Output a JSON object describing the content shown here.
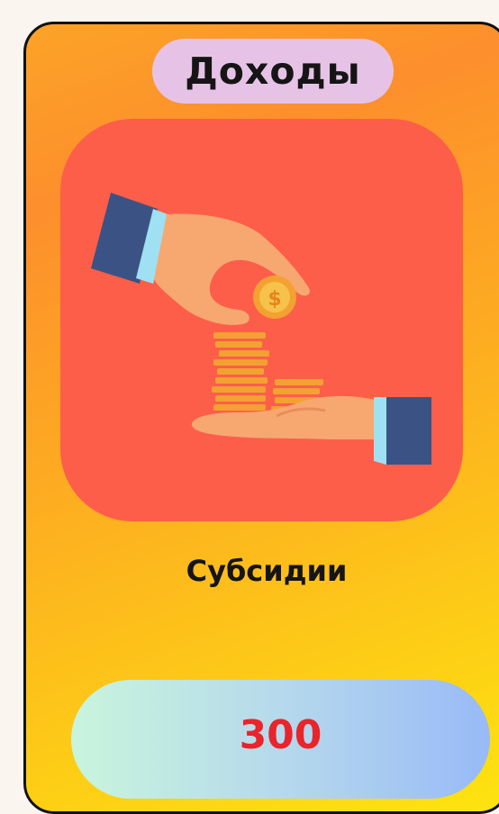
{
  "card": {
    "title": "Доходы",
    "label": "Субсидии",
    "value": "300",
    "illustration": "hands-giving-coins",
    "colors": {
      "card_gradient_top": "#fd8f2c",
      "card_gradient_bottom": "#fde40f",
      "title_pill": "#e6c3e6",
      "image_background": "#fd5e4a",
      "value_text": "#e8252a",
      "value_pill_start": "#c8f5dc",
      "value_pill_end": "#98baf7"
    }
  }
}
